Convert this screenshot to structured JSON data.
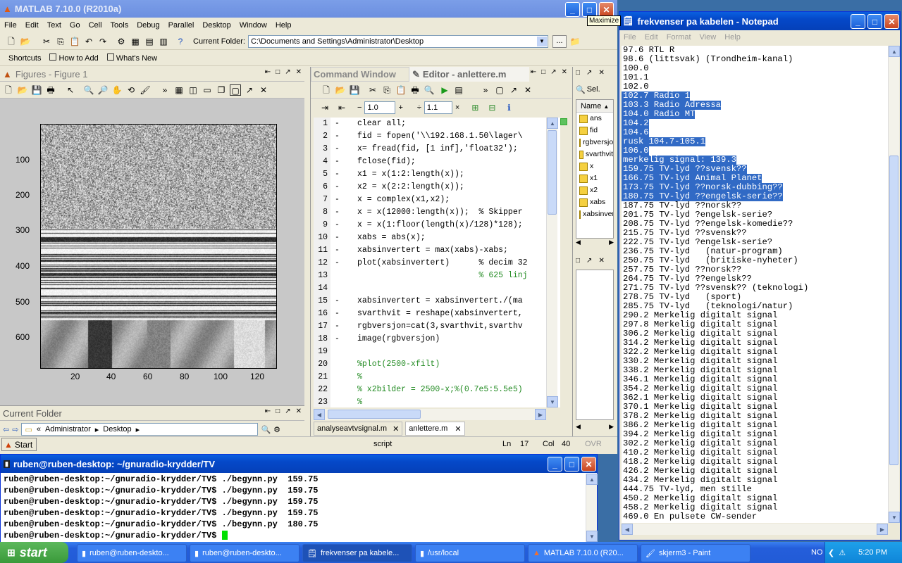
{
  "desktop": {
    "background": "#3a6ea5"
  },
  "matlab": {
    "title": "MATLAB  7.10.0 (R2010a)",
    "menus": [
      "File",
      "Edit",
      "Text",
      "Go",
      "Cell",
      "Tools",
      "Debug",
      "Parallel",
      "Desktop",
      "Window",
      "Help"
    ],
    "current_folder_label": "Current Folder:",
    "current_folder_value": "C:\\Documents and Settings\\Administrator\\Desktop",
    "browse_button": "...",
    "shortcuts": [
      "Shortcuts",
      "How to Add",
      "What's New"
    ],
    "figures": {
      "title": "Figures - Figure 1",
      "y_ticks": [
        "100",
        "200",
        "300",
        "400",
        "500",
        "600"
      ],
      "x_ticks": [
        "20",
        "40",
        "60",
        "80",
        "100",
        "120"
      ]
    },
    "current_folder_panel": {
      "title": "Current Folder",
      "breadcrumb": [
        "«",
        "Administrator",
        "Desktop"
      ]
    },
    "start_button": "Start",
    "command_window_tab": "Command Window",
    "editor": {
      "title": "Editor - anlettere.m",
      "step_value": "1.0",
      "step_value2": "1.1",
      "lines": [
        {
          "n": "1",
          "code": "clear all;"
        },
        {
          "n": "2",
          "code": "fid = fopen('\\\\192.168.1.50\\lager\\"
        },
        {
          "n": "3",
          "code": "x= fread(fid, [1 inf],'float32');"
        },
        {
          "n": "4",
          "code": "fclose(fid);"
        },
        {
          "n": "5",
          "code": "x1 = x(1:2:length(x));"
        },
        {
          "n": "6",
          "code": "x2 = x(2:2:length(x));"
        },
        {
          "n": "7",
          "code": "x = complex(x1,x2);"
        },
        {
          "n": "8",
          "code": "x = x(12000:length(x));  % Skipper"
        },
        {
          "n": "9",
          "code": "x = x(1:floor(length(x)/128)*128);"
        },
        {
          "n": "10",
          "code": "xabs = abs(x);"
        },
        {
          "n": "11",
          "code": "xabsinvertert = max(xabs)-xabs;"
        },
        {
          "n": "12",
          "code": "plot(xabsinvertert)      % decim 32"
        },
        {
          "n": "13",
          "code": "                         % 625 linj"
        },
        {
          "n": "14",
          "code": ""
        },
        {
          "n": "15",
          "code": "xabsinvertert = xabsinvertert./(ma"
        },
        {
          "n": "16",
          "code": "svarthvit = reshape(xabsinvertert,"
        },
        {
          "n": "17",
          "code": "rgbversjon=cat(3,svarthvit,svarthv"
        },
        {
          "n": "18",
          "code": "image(rgbversjon)"
        },
        {
          "n": "19",
          "code": ""
        },
        {
          "n": "20",
          "code": "%plot(2500-xfilt)"
        },
        {
          "n": "21",
          "code": "%"
        },
        {
          "n": "22",
          "code": "% x2bilder = 2500-x;%(0.7e5:5.5e5)"
        },
        {
          "n": "23",
          "code": "%"
        }
      ],
      "tabs": [
        "analyseavtvsignal.m",
        "anlettere.m"
      ]
    },
    "statusbar": {
      "mode": "script",
      "ln_label": "Ln",
      "ln": "17",
      "col_label": "Col",
      "col": "40",
      "ovr": "OVR"
    },
    "workspace": {
      "select_label": "Sel.",
      "column": "Name",
      "vars": [
        "ans",
        "fid",
        "rgbversjon",
        "svarthvit",
        "x",
        "x1",
        "x2",
        "xabs",
        "xabsinvertert"
      ]
    }
  },
  "notepad": {
    "title": "frekvenser pa kabelen - Notepad",
    "menus": [
      "File",
      "Edit",
      "Format",
      "View",
      "Help"
    ],
    "tooltip": "Maximize",
    "lines": [
      {
        "t": "97.6 RTL R",
        "sel": false
      },
      {
        "t": "98.6 (littsvak) (Trondheim-kanal)",
        "sel": false
      },
      {
        "t": "100.0",
        "sel": false
      },
      {
        "t": "101.1",
        "sel": false
      },
      {
        "t": "102.0",
        "sel": false
      },
      {
        "t": "102.7 Radio 1",
        "sel": true
      },
      {
        "t": "103.3 Radio Adressa",
        "sel": true
      },
      {
        "t": "104.0 Radio MT",
        "sel": true
      },
      {
        "t": "104.2",
        "sel": true
      },
      {
        "t": "104.6",
        "sel": true
      },
      {
        "t": "rusk 104.7-105.1",
        "sel": true
      },
      {
        "t": "106.0",
        "sel": true
      },
      {
        "t": "merkelig signal: 139.3",
        "sel": true
      },
      {
        "t": "159.75 TV-lyd ??svensk??",
        "sel": true
      },
      {
        "t": "166.75 TV-lyd Animal Planet",
        "sel": true
      },
      {
        "t": "173.75 TV-lyd ??norsk-dubbing??",
        "sel": true
      },
      {
        "t": "180.75 TV-lyd ??engelsk-serie??",
        "sel": true
      },
      {
        "t": "187.75 TV-lyd ??norsk??",
        "sel": false
      },
      {
        "t": "201.75 TV-lyd ?engelsk-serie?",
        "sel": false
      },
      {
        "t": "208.75 TV-lyd ??engelsk-komedie??",
        "sel": false
      },
      {
        "t": "215.75 TV-lyd ??svensk??",
        "sel": false
      },
      {
        "t": "222.75 TV-lyd ?engelsk-serie?",
        "sel": false
      },
      {
        "t": "236.75 TV-lyd   (natur-program)",
        "sel": false
      },
      {
        "t": "250.75 TV-lyd   (britiske-nyheter)",
        "sel": false
      },
      {
        "t": "257.75 TV-lyd ??norsk??",
        "sel": false
      },
      {
        "t": "264.75 TV-lyd ??engelsk??",
        "sel": false
      },
      {
        "t": "271.75 TV-lyd ??svensk?? (teknologi)",
        "sel": false
      },
      {
        "t": "278.75 TV-lyd   (sport)",
        "sel": false
      },
      {
        "t": "285.75 TV-lyd   (teknologi/natur)",
        "sel": false
      },
      {
        "t": "290.2 Merkelig digitalt signal",
        "sel": false
      },
      {
        "t": "297.8 Merkelig digitalt signal",
        "sel": false
      },
      {
        "t": "306.2 Merkelig digitalt signal",
        "sel": false
      },
      {
        "t": "314.2 Merkelig digitalt signal",
        "sel": false
      },
      {
        "t": "322.2 Merkelig digitalt signal",
        "sel": false
      },
      {
        "t": "330.2 Merkelig digitalt signal",
        "sel": false
      },
      {
        "t": "338.2 Merkelig digitalt signal",
        "sel": false
      },
      {
        "t": "346.1 Merkelig digitalt signal",
        "sel": false
      },
      {
        "t": "354.2 Merkelig digitalt signal",
        "sel": false
      },
      {
        "t": "362.1 Merkelig digitalt signal",
        "sel": false
      },
      {
        "t": "370.1 Merkelig digitalt signal",
        "sel": false
      },
      {
        "t": "378.2 Merkelig digitalt signal",
        "sel": false
      },
      {
        "t": "386.2 Merkelig digitalt signal",
        "sel": false
      },
      {
        "t": "394.2 Merkelig digitalt signal",
        "sel": false
      },
      {
        "t": "302.2 Merkelig digitalt signal",
        "sel": false
      },
      {
        "t": "410.2 Merkelig digitalt signal",
        "sel": false
      },
      {
        "t": "418.2 Merkelig digitalt signal",
        "sel": false
      },
      {
        "t": "426.2 Merkelig digitalt signal",
        "sel": false
      },
      {
        "t": "434.2 Merkelig digitalt signal",
        "sel": false
      },
      {
        "t": "444.75 TV-lyd, men stille",
        "sel": false
      },
      {
        "t": "450.2 Merkelig digitalt signal",
        "sel": false
      },
      {
        "t": "458.2 Merkelig digitalt signal",
        "sel": false
      },
      {
        "t": "469.0 En pulsete CW-sender",
        "sel": false
      }
    ]
  },
  "terminal": {
    "title": "ruben@ruben-desktop: ~/gnuradio-krydder/TV",
    "lines": [
      "ruben@ruben-desktop:~/gnuradio-krydder/TV$ ./begynn.py  159.75",
      "ruben@ruben-desktop:~/gnuradio-krydder/TV$ ./begynn.py  159.75",
      "ruben@ruben-desktop:~/gnuradio-krydder/TV$ ./begynn.py  159.75",
      "ruben@ruben-desktop:~/gnuradio-krydder/TV$ ./begynn.py  159.75",
      "ruben@ruben-desktop:~/gnuradio-krydder/TV$ ./begynn.py  180.75",
      "ruben@ruben-desktop:~/gnuradio-krydder/TV$ "
    ]
  },
  "taskbar": {
    "start": "start",
    "items": [
      "ruben@ruben-deskto...",
      "ruben@ruben-deskto...",
      "frekvenser pa kabele...",
      "/usr/local",
      "MATLAB  7.10.0 (R20...",
      "skjerm3 - Paint"
    ],
    "lang": "NO",
    "clock": "5:20 PM"
  }
}
